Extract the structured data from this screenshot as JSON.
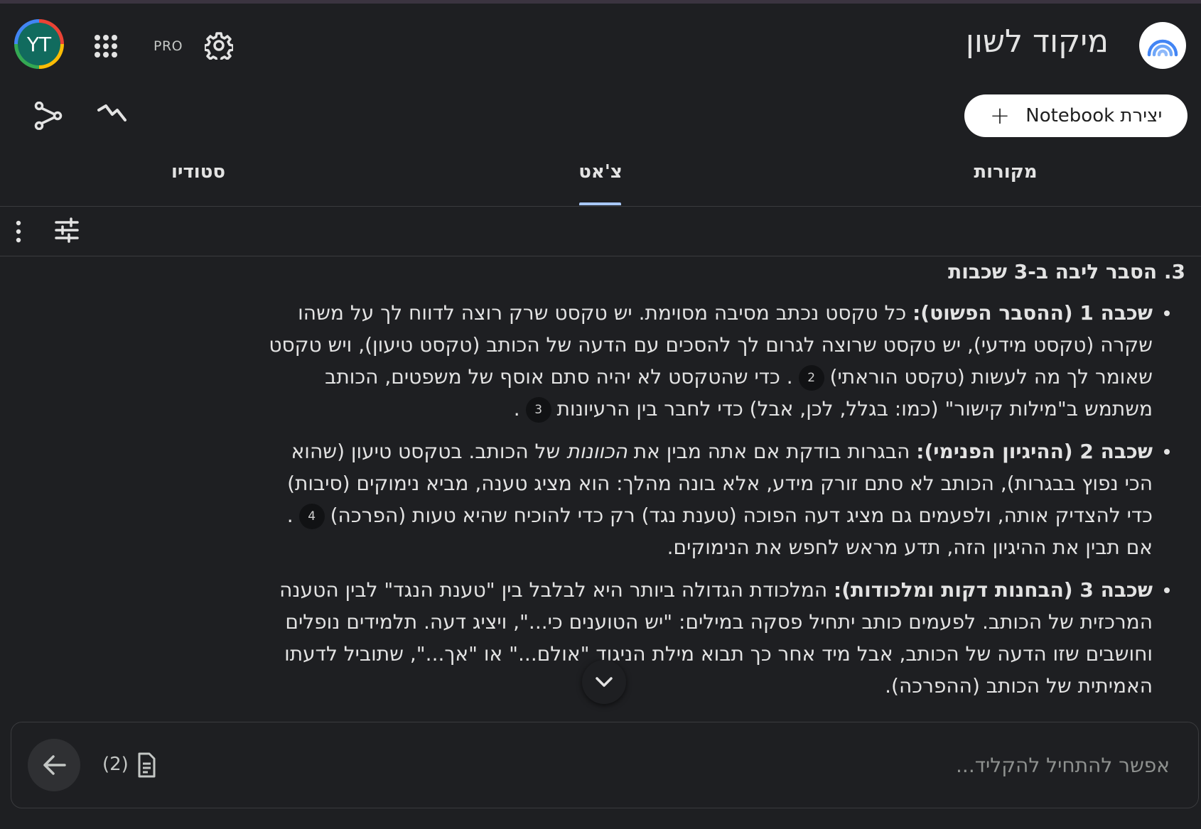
{
  "header": {
    "title": "מיקוד לשון",
    "avatar_initials": "YT",
    "plan_badge": "PRO",
    "create_button_label": "יצירת Notebook",
    "create_button_icon": "plus-icon"
  },
  "tabs": [
    {
      "label": "מקורות",
      "active": false
    },
    {
      "label": "צ'אט",
      "active": true
    },
    {
      "label": "סטודיו",
      "active": false
    }
  ],
  "content": {
    "heading": "3. הסבר ליבה ב-3 שכבות",
    "bullets": [
      {
        "title": "שכבה 1 (ההסבר הפשוט):",
        "text_1": " כל טקסט נכתב מסיבה מסוימת. יש טקסט שרק רוצה לדווח לך על משהו שקרה (טקסט מידעי), יש טקסט שרוצה לגרום לך להסכים עם הדעה של הכותב (טקסט טיעון), ויש טקסט שאומר לך מה לעשות (טקסט הוראתי)",
        "cite_1": "2",
        "text_2": ". כדי שהטקסט לא יהיה סתם אוסף של משפטים, הכותב משתמש ב\"מילות קישור\" (כמו: בגלל, לכן, אבל) כדי לחבר בין הרעיונות",
        "cite_2": "3",
        "text_3": "."
      },
      {
        "title": "שכבה 2 (ההיגיון הפנימי):",
        "text_1": " הבגרות בודקת אם אתה מבין את ",
        "emph": "הכוונות",
        "text_2": " של הכותב. בטקסט טיעון (שהוא הכי נפוץ בבגרות), הכותב לא סתם זורק מידע, אלא בונה מהלך: הוא מציג טענה, מביא נימוקים (סיבות) כדי להצדיק אותה, ולפעמים גם מציג דעה הפוכה (טענת נגד) רק כדי להוכיח שהיא טעות (הפרכה)",
        "cite_1": "4",
        "text_3": ". אם תבין את ההיגיון הזה, תדע מראש לחפש את הנימוקים."
      },
      {
        "title": "שכבה 3 (הבחנות דקות ומלכודות):",
        "text_1": " המלכודת הגדולה ביותר היא לבלבל בין \"טענת הנגד\" לבין הטענה המרכזית של הכותב. לפעמים כותב יתחיל פסקה במילים: \"יש הטוענים כי...\", ויציג דעה. תלמידים נופלים וחושבים שזו הדעה של הכותב, אבל מיד אחר כך תבוא מילת הניגוד \"אולם...\" או \"אך...\", שתוביל לדעתו האמיתית של הכותב (ההפרכה)."
      }
    ]
  },
  "composer": {
    "placeholder": "אפשר להתחיל להקליד...",
    "source_count": "(2)"
  },
  "colors": {
    "background": "#1e1f22",
    "accent_tab": "#a8c7fa",
    "avatar_bg": "#116b5e"
  }
}
